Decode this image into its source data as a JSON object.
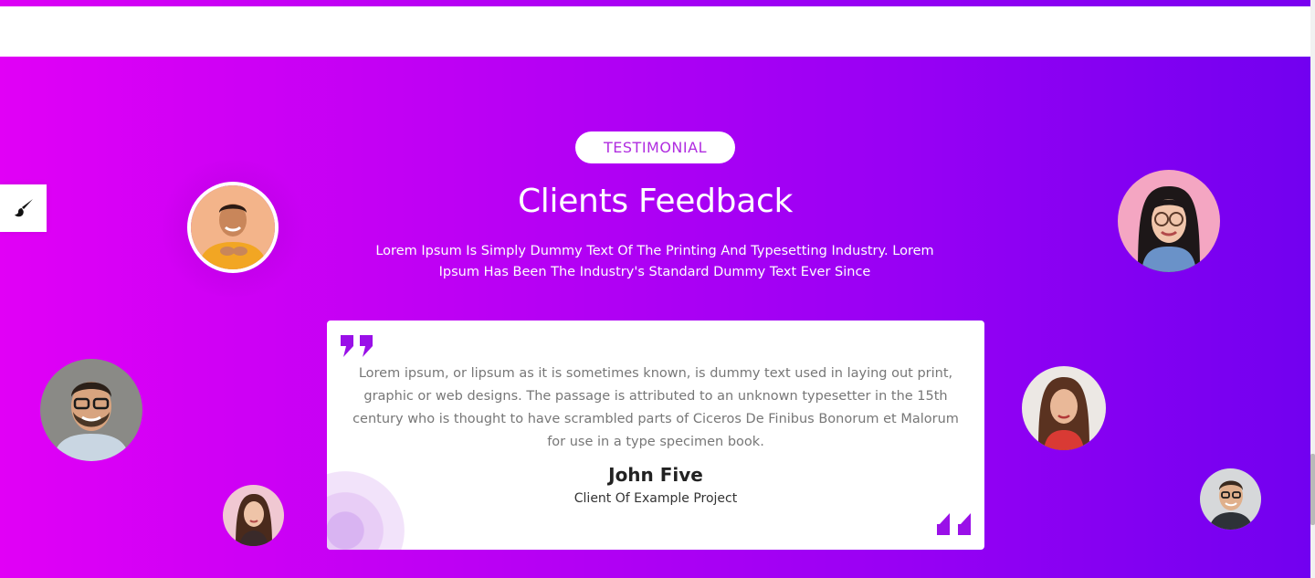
{
  "section": {
    "badge": "TESTIMONIAL",
    "title": "Clients Feedback",
    "subtitle": "Lorem Ipsum Is Simply Dummy Text Of The Printing And Typesetting Industry. Lorem Ipsum Has Been The Industry's Standard Dummy Text Ever Since"
  },
  "testimonial": {
    "quote": "Lorem ipsum, or lipsum as it is sometimes known, is dummy text used in laying out print, graphic or web designs. The passage is attributed to an unknown typesetter in the 15th century who is thought to have scrambled parts of Ciceros De Finibus Bonorum et Malorum for use in a type specimen book.",
    "name": "John Five",
    "role": "Client Of Example Project"
  },
  "icons": {
    "style_switcher": "paint-brush-icon",
    "quote_open": "quote-open-icon",
    "quote_close": "quote-close-icon"
  },
  "colors": {
    "gradient_start": "#e100f6",
    "gradient_end": "#7200f0",
    "badge_text": "#b02de0",
    "quote_mark": "#9a10e8"
  }
}
